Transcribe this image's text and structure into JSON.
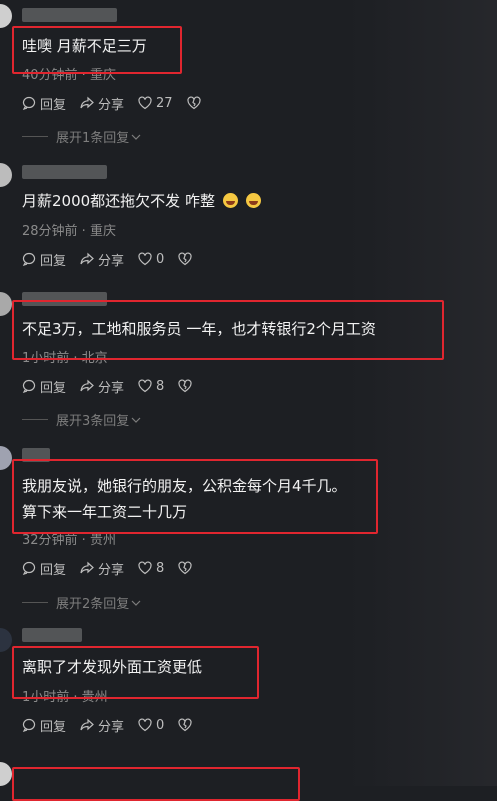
{
  "comments": [
    {
      "text": "哇噢 月薪不足三万",
      "meta": "40分钟前 · 重庆",
      "likes": "27"
    },
    {
      "text": "月薪2000都还拖欠不发 咋整",
      "meta": "28分钟前 · 重庆",
      "likes": "0"
    },
    {
      "text": "不足3万，工地和服务员 一年，也才转银行2个月工资",
      "meta": "1小时前 · 北京",
      "likes": "8"
    },
    {
      "text_line1": "我朋友说，她银行的朋友，公积金每个月4千几。",
      "text_line2": "算下来一年工资二十几万",
      "meta": "32分钟前 · 贵州",
      "likes": "8"
    },
    {
      "text": "离职了才发现外面工资更低",
      "meta": "1小时前 · 贵州",
      "likes": "0"
    }
  ],
  "labels": {
    "reply": "回复",
    "share": "分享"
  },
  "expands": [
    "展开1条回复",
    "展开3条回复",
    "展开2条回复"
  ],
  "colors": {
    "highlight": "#e0262f",
    "background": "#1d1f23"
  }
}
